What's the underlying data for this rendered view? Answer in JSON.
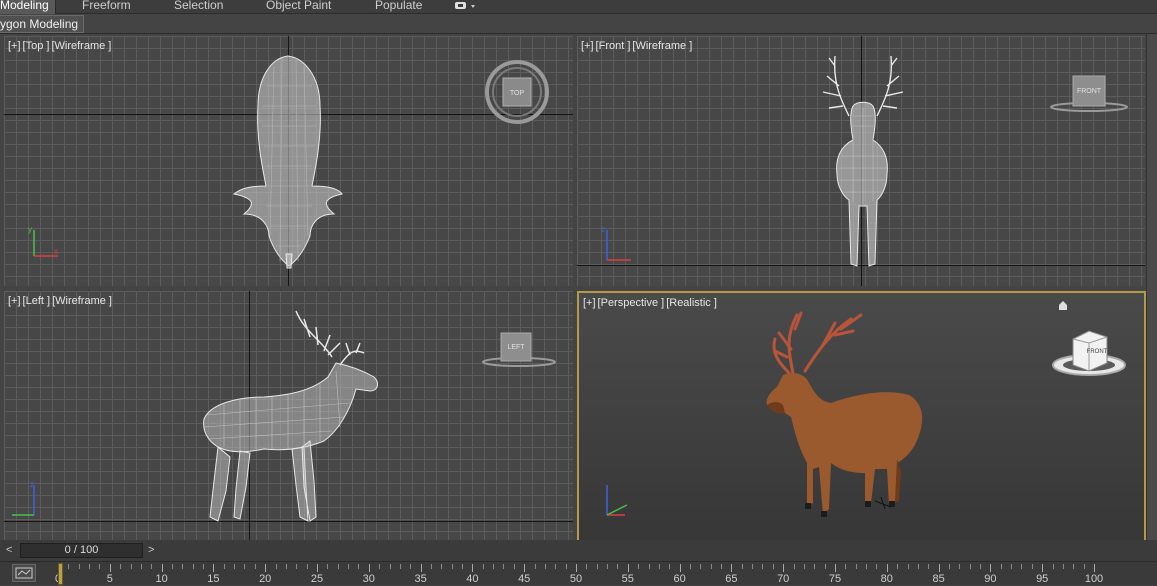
{
  "ribbon": {
    "tabs": [
      "Modeling",
      "Freeform",
      "Selection",
      "Object Paint",
      "Populate"
    ],
    "active_tab": "Modeling",
    "subtab": "ygon Modeling"
  },
  "viewports": {
    "top": {
      "plus": "[+]",
      "name": "[Top ]",
      "mode": "[Wireframe ]",
      "cube_label": "TOP"
    },
    "front": {
      "plus": "[+]",
      "name": "[Front ]",
      "mode": "[Wireframe ]",
      "cube_label": "FRONT"
    },
    "left": {
      "plus": "[+]",
      "name": "[Left ]",
      "mode": "[Wireframe ]",
      "cube_label": "LEFT"
    },
    "perspective": {
      "plus": "[+]",
      "name": "[Perspective ]",
      "mode": "[Realistic ]",
      "cube_label": "FRONT"
    }
  },
  "time_slider": {
    "left_arrow": "<",
    "value": "0 / 100",
    "right_arrow": ">"
  },
  "timeline": {
    "labels": [
      "0",
      "5",
      "10",
      "15",
      "20",
      "25",
      "30",
      "35",
      "40",
      "45",
      "50",
      "55",
      "60",
      "65",
      "70",
      "75",
      "80",
      "85",
      "90",
      "95",
      "100"
    ]
  },
  "colors": {
    "active_viewport_border": "#b59a4a",
    "grid": "#5c5c5c",
    "wireframe": "#e8e8e8",
    "deer_body": "#9a5a2e",
    "antler": "#b8543a"
  }
}
